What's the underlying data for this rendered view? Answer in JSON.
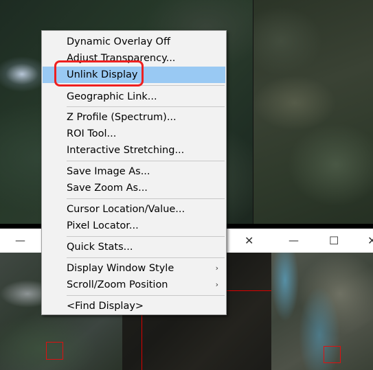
{
  "context_menu": {
    "items": [
      {
        "label": "Dynamic Overlay Off"
      },
      {
        "label": "Adjust Transparency..."
      },
      {
        "label": "Unlink Display",
        "highlighted": true
      },
      {
        "label": "Geographic Link..."
      },
      {
        "label": "Z Profile (Spectrum)..."
      },
      {
        "label": "ROI Tool..."
      },
      {
        "label": "Interactive Stretching..."
      },
      {
        "label": "Save Image As..."
      },
      {
        "label": "Save Zoom As..."
      },
      {
        "label": "Cursor Location/Value..."
      },
      {
        "label": "Pixel Locator..."
      },
      {
        "label": "Quick Stats..."
      },
      {
        "label": "Display Window Style",
        "submenu": true
      },
      {
        "label": "Scroll/Zoom Position",
        "submenu": true
      },
      {
        "label": "<Find Display>"
      }
    ],
    "submenu_arrow": "›"
  },
  "windows": {
    "minimize_icon": "—",
    "maximize_icon": "☐",
    "close_icon": "✕"
  },
  "colors": {
    "menu_background": "#f2f2f2",
    "highlight": "#99c9f3",
    "annotation_red": "#ee2020",
    "roi_red": "#e01010"
  }
}
